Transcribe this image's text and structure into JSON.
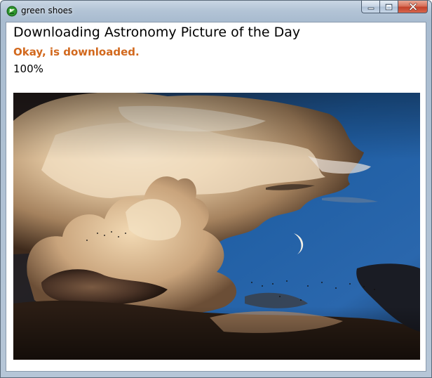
{
  "window": {
    "title": "green shoes",
    "app_icon": "green-shoes-logo-icon",
    "caption_buttons": [
      "minimize-icon",
      "maximize-icon",
      "close-icon"
    ]
  },
  "content": {
    "heading": "Downloading Astronomy Picture of the Day",
    "status": "Okay, is downloaded.",
    "progress_text": "100%",
    "progress": 1.0
  },
  "image": {
    "description_icon": "downloaded-apod-image"
  },
  "colors": {
    "status_text": "#d2691e",
    "close_button": "#c2412a",
    "sky_blue": "#1b5fa6",
    "cloud_highlight": "#f4e3c8"
  }
}
